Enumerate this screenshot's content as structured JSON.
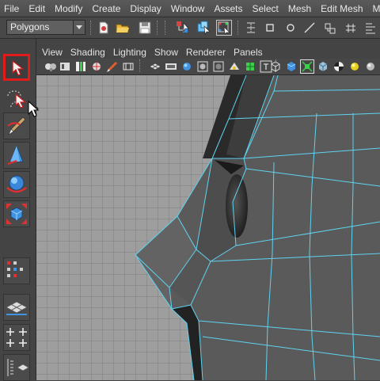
{
  "menubar": {
    "items": [
      "File",
      "Edit",
      "Modify",
      "Create",
      "Display",
      "Window",
      "Assets",
      "Select",
      "Mesh",
      "Edit Mesh",
      "Mesh"
    ]
  },
  "statusline": {
    "mode": "Polygons"
  },
  "panel": {
    "menus": [
      "View",
      "Shading",
      "Lighting",
      "Show",
      "Renderer",
      "Panels"
    ]
  },
  "colors": {
    "selection_highlight": "#e21b1b",
    "wireframe": "#5fd3f0",
    "viewport_background": "#9e9e9e",
    "mesh_surface": "#5a5a5a"
  },
  "icons": {
    "toolbox": [
      "select-arrow-icon",
      "lasso-select-icon",
      "paint-select-icon",
      "move-icon",
      "rotate-icon",
      "scale-icon",
      "layout-icon",
      "perspective-grid-icon",
      "four-view-icon",
      "outliner-icon"
    ],
    "statusline": [
      "new-scene-icon",
      "open-scene-icon",
      "save-scene-icon",
      "select-hierarchy-icon",
      "select-object-icon",
      "select-component-icon",
      "snap-curve-icon",
      "snap-point-icon",
      "snap-view-icon",
      "snap-plane-icon",
      "history-icon",
      "render-icon"
    ]
  }
}
